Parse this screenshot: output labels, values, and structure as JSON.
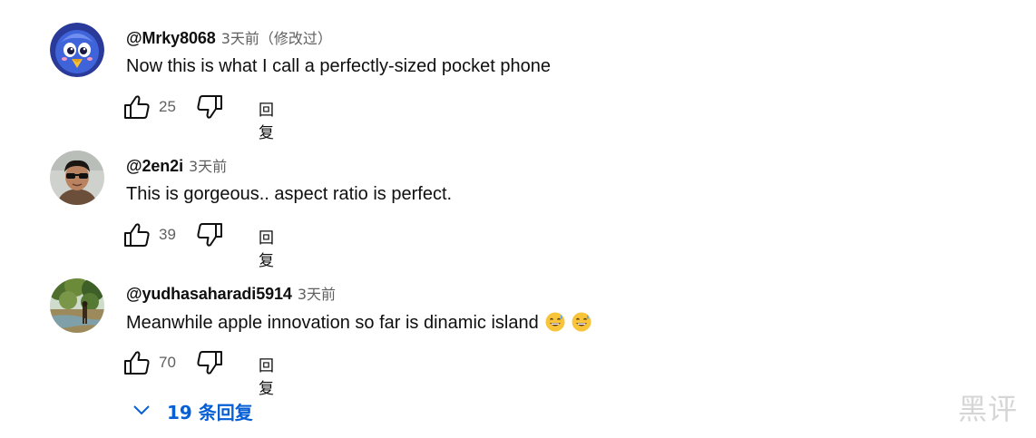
{
  "comments": [
    {
      "author": "@Mrky8068",
      "time": "3天前",
      "edited": "（修改过）",
      "text": "Now this is what I call a perfectly-sized pocket phone",
      "likes": "25",
      "reply_label": "回复",
      "avatar_icon": "blue-bird-avatar-icon"
    },
    {
      "author": "@2en2i",
      "time": "3天前",
      "text": "This is gorgeous.. aspect ratio is perfect.",
      "likes": "39",
      "reply_label": "回复",
      "avatar_icon": "man-with-sunglasses-avatar-icon"
    },
    {
      "author": "@yudhasaharadi5914",
      "time": "3天前",
      "text": "Meanwhile apple innovation so far is dinamic island",
      "emojis": [
        "grinning-sweat-emoji",
        "grinning-sweat-emoji"
      ],
      "likes": "70",
      "reply_label": "回复",
      "avatar_icon": "forest-river-avatar-icon"
    }
  ],
  "replies_toggle": {
    "label": "19 条回复",
    "icon": "chevron-down-icon",
    "color": "#065fd4"
  },
  "watermark": "黑评"
}
